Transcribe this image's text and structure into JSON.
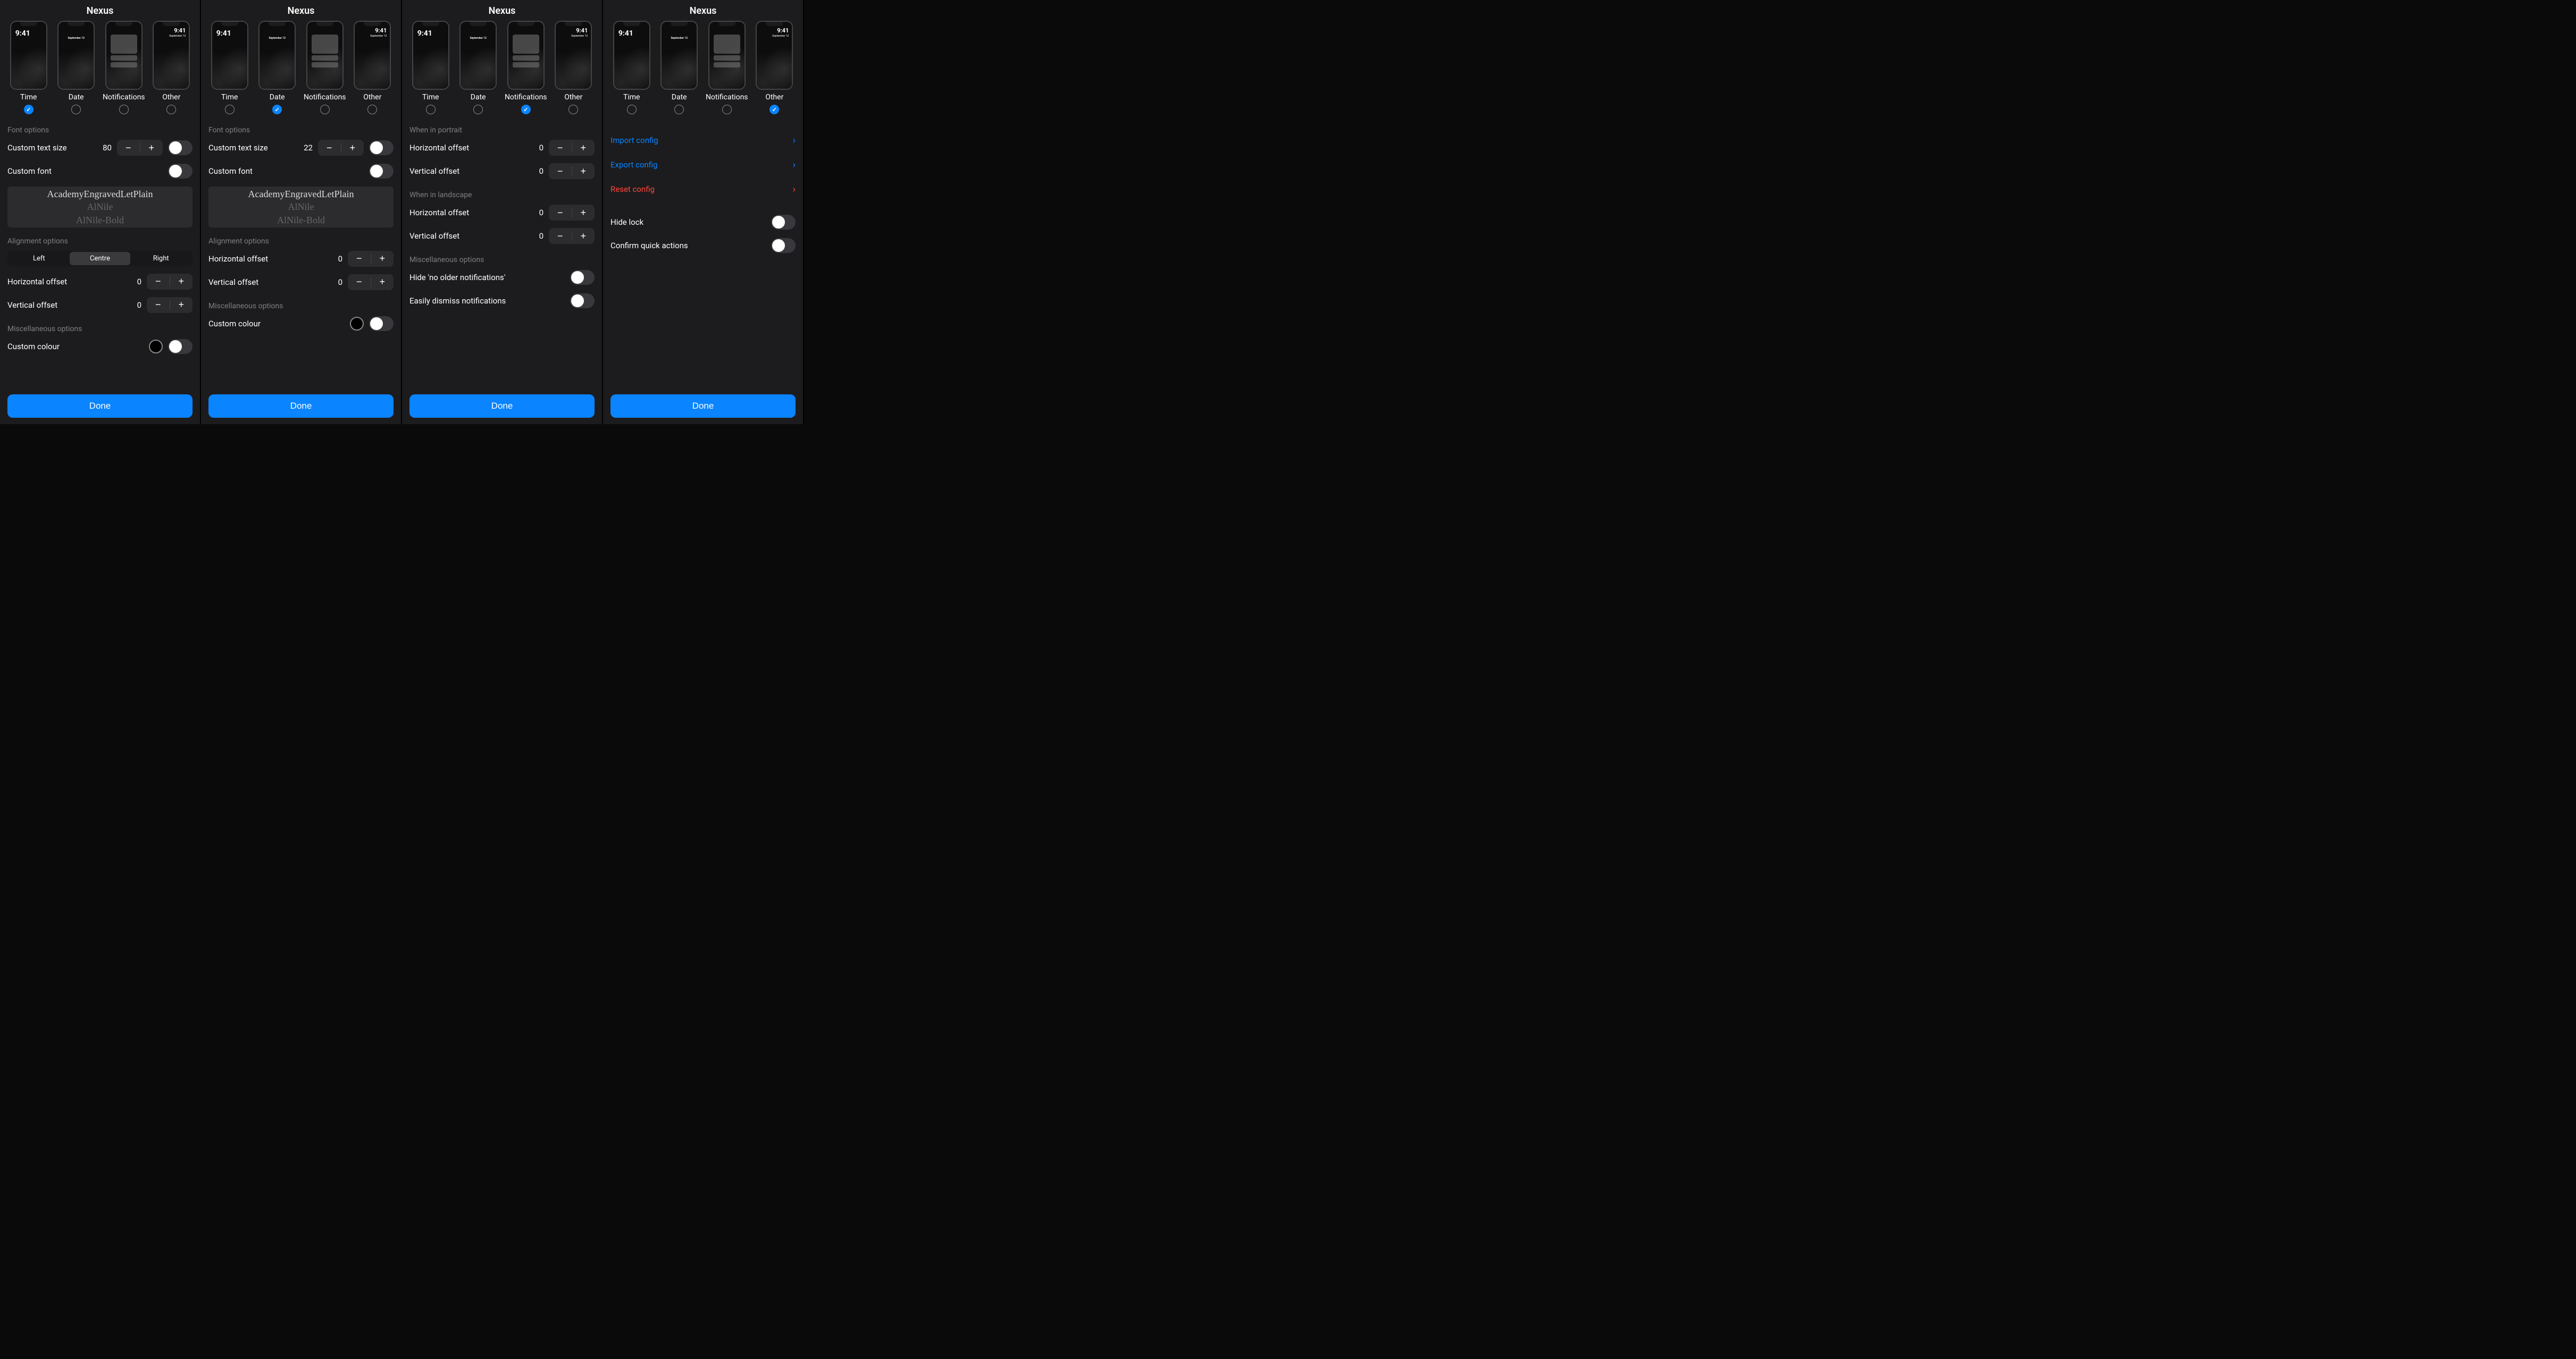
{
  "app_title": "Nexus",
  "tabs": {
    "time": "Time",
    "date": "Date",
    "notifications": "Notifications",
    "other": "Other"
  },
  "phone": {
    "time": "9:41",
    "date": "September 12"
  },
  "done": "Done",
  "screen1": {
    "selected": "time",
    "font_section": "Font options",
    "custom_text_size_label": "Custom text size",
    "custom_text_size_value": "80",
    "custom_font_label": "Custom font",
    "custom_font_on": true,
    "fonts": [
      "AcademyEngravedLetPlain",
      "AlNile",
      "AlNile-Bold"
    ],
    "align_section": "Alignment options",
    "align": {
      "left": "Left",
      "centre": "Centre",
      "right": "Right",
      "selected": "centre"
    },
    "h_offset_label": "Horizontal offset",
    "h_offset_value": "0",
    "v_offset_label": "Vertical offset",
    "v_offset_value": "0",
    "misc_section": "Miscellaneous options",
    "custom_colour_label": "Custom colour",
    "custom_colour_on": true
  },
  "screen2": {
    "selected": "date",
    "font_section": "Font options",
    "custom_text_size_label": "Custom text size",
    "custom_text_size_value": "22",
    "custom_font_label": "Custom font",
    "custom_font_on": true,
    "fonts": [
      "AcademyEngravedLetPlain",
      "AlNile",
      "AlNile-Bold"
    ],
    "align_section": "Alignment options",
    "h_offset_label": "Horizontal offset",
    "h_offset_value": "0",
    "v_offset_label": "Vertical offset",
    "v_offset_value": "0",
    "misc_section": "Miscellaneous options",
    "custom_colour_label": "Custom colour",
    "custom_colour_on": true
  },
  "screen3": {
    "selected": "notifications",
    "portrait_section": "When in portrait",
    "h_offset_label": "Horizontal offset",
    "p_h_offset_value": "0",
    "v_offset_label": "Vertical offset",
    "p_v_offset_value": "0",
    "landscape_section": "When in landscape",
    "l_h_offset_value": "0",
    "l_v_offset_value": "0",
    "misc_section": "Miscellaneous options",
    "hide_older_label": "Hide 'no older notifications'",
    "hide_older_on": true,
    "dismiss_label": "Easily dismiss notifications",
    "dismiss_on": true
  },
  "screen4": {
    "selected": "other",
    "import_label": "Import config",
    "export_label": "Export config",
    "reset_label": "Reset config",
    "hide_lock_label": "Hide lock",
    "hide_lock_on": true,
    "confirm_label": "Confirm quick actions",
    "confirm_on": true
  }
}
